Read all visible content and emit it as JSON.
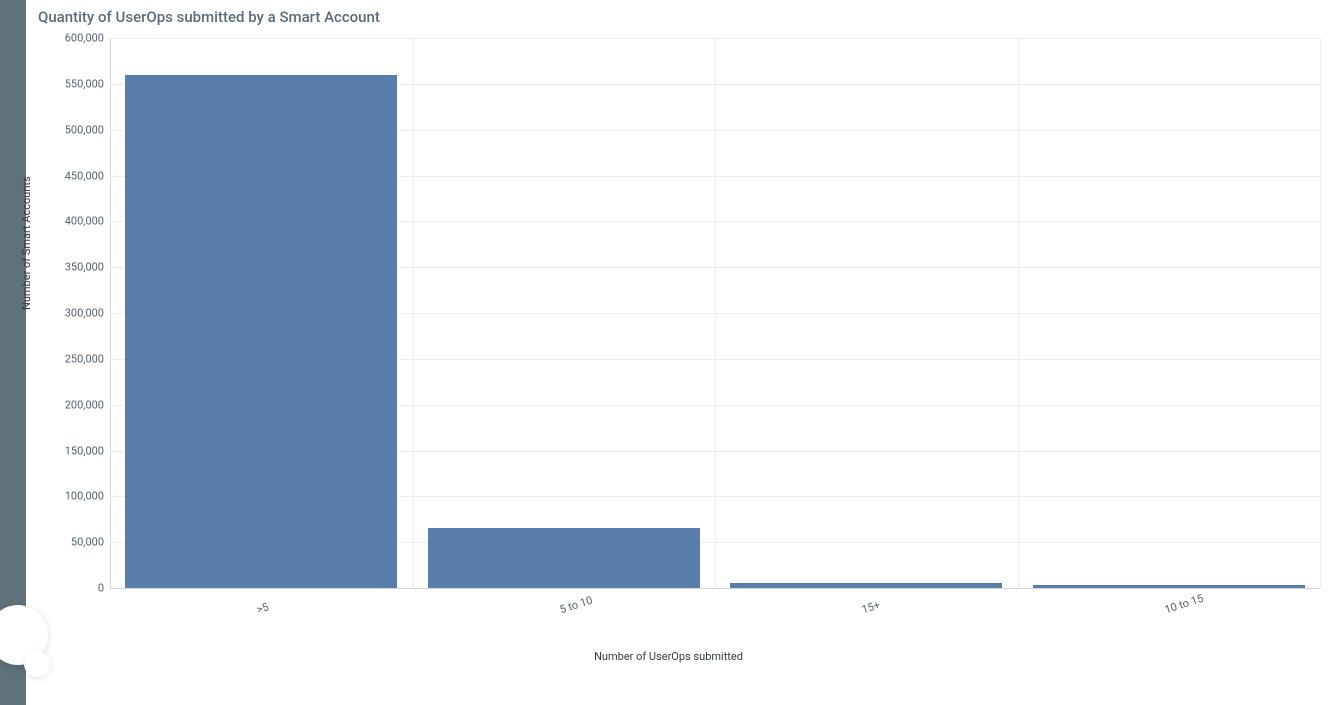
{
  "title": "Quantity of UserOps submitted by a Smart Account",
  "chart_data": {
    "type": "bar",
    "categories": [
      ">5",
      "5 to 10",
      "15+",
      "10 to 15"
    ],
    "values": [
      560000,
      65000,
      5000,
      3000
    ],
    "xlabel": "Number of UserOps submitted",
    "ylabel": "Number of Smart Accounts",
    "ylim": [
      0,
      600000
    ],
    "yticks": [
      0,
      50000,
      100000,
      150000,
      200000,
      250000,
      300000,
      350000,
      400000,
      450000,
      500000,
      550000,
      600000
    ],
    "ytick_labels": [
      "0",
      "50,000",
      "100,000",
      "150,000",
      "200,000",
      "250,000",
      "300,000",
      "350,000",
      "400,000",
      "450,000",
      "500,000",
      "550,000",
      "600,000"
    ]
  },
  "style": {
    "bar_color": "#5a7eab"
  }
}
